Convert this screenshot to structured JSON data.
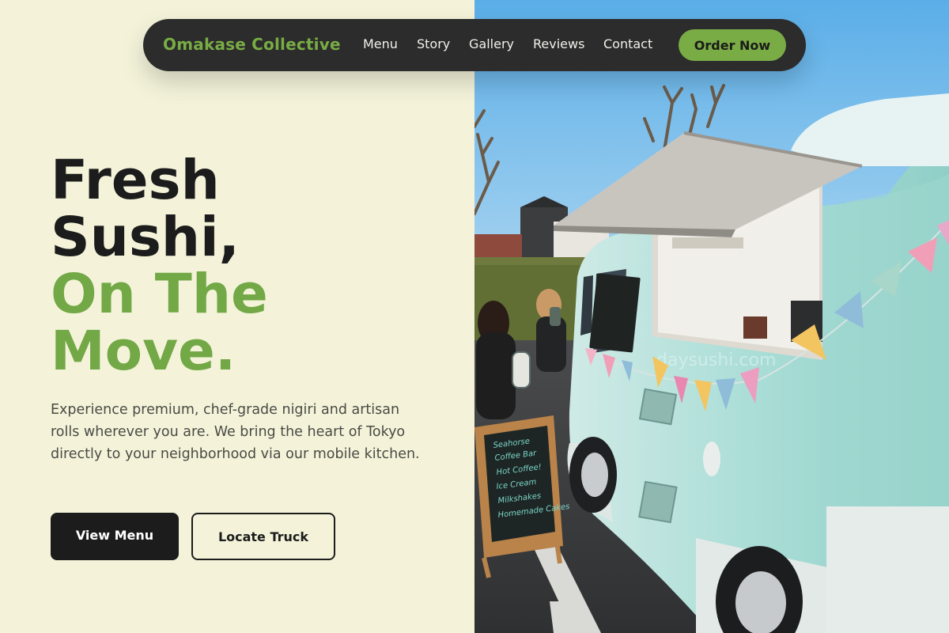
{
  "nav": {
    "brand": "Omakase Collective",
    "links": [
      "Menu",
      "Story",
      "Gallery",
      "Reviews",
      "Contact"
    ],
    "cta": "Order Now"
  },
  "hero": {
    "headline_line1": "Fresh",
    "headline_line2": "Sushi,",
    "headline_accent_line1": "On The",
    "headline_accent_line2": "Move.",
    "description": "Experience premium, chef-grade nigiri and artisan rolls wherever you are. We bring the heart of Tokyo directly to your neighborhood via our mobile kitchen.",
    "primary_button": "View Menu",
    "secondary_button": "Locate Truck"
  },
  "photo": {
    "truck_window_text": "daysushi.com",
    "sign_lines": [
      "Seahorse",
      "Coffee Bar",
      "Hot Coffee!",
      "Ice Cream",
      "Milkshakes",
      "Homemade Cakes"
    ]
  },
  "colors": {
    "accent": "#79ac45",
    "dark": "#1c1c1c",
    "cream": "#f4f3da",
    "nav_bg": "#2b2c2b"
  }
}
